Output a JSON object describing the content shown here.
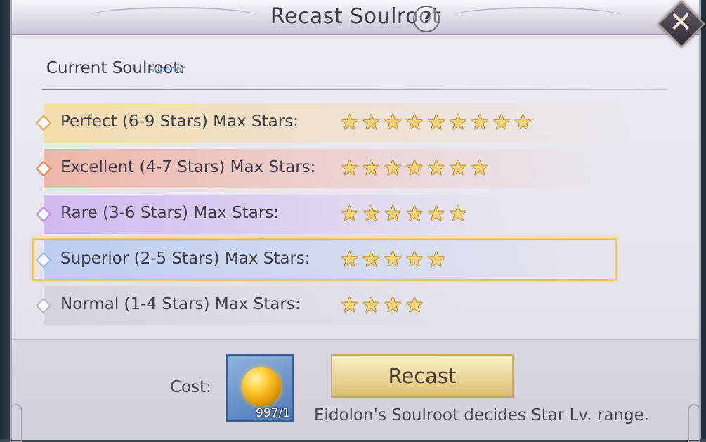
{
  "dialog": {
    "title": "Recast Soulroot",
    "help_icon": "question-mark-icon",
    "close_icon": "close-x-icon"
  },
  "current": {
    "label": "Current Soulroot:",
    "value": "Superior"
  },
  "grades": [
    {
      "label": "Perfect (6-9 Stars) Max Stars:",
      "max_stars": 9,
      "stars": "★★★★★★★★★",
      "band": "linear-gradient(90deg, rgba(247,218,150,0.75) 0%, rgba(243,221,190,0.55) 55%, rgba(235,230,240,0) 100%)",
      "accent": "#f0a040",
      "selected": false
    },
    {
      "label": "Excellent (4-7 Stars) Max Stars:",
      "max_stars": 7,
      "stars": "★★★★★★★",
      "band": "linear-gradient(90deg, rgba(240,170,150,0.8) 0%, rgba(238,195,188,0.55) 55%, rgba(235,230,240,0) 100%)",
      "accent": "#ef7a4a",
      "selected": false
    },
    {
      "label": "Rare (3-6 Stars) Max Stars:",
      "max_stars": 6,
      "stars": "★★★★★★",
      "band": "linear-gradient(90deg, rgba(200,170,240,0.75) 0%, rgba(210,195,240,0.55) 55%, rgba(235,230,240,0) 100%)",
      "accent": "#b58bec",
      "selected": false
    },
    {
      "label": "Superior (2-5 Stars) Max Stars:",
      "max_stars": 5,
      "stars": "★★★★★",
      "band": "linear-gradient(90deg, rgba(170,195,240,0.7) 0%, rgba(195,210,242,0.55) 55%, rgba(235,230,240,0) 100%)",
      "accent": "#8fb0ec",
      "selected": true
    },
    {
      "label": "Normal (1-4 Stars) Max Stars:",
      "max_stars": 4,
      "stars": "★★★★",
      "band": "linear-gradient(90deg, rgba(205,205,215,0.7) 0%, rgba(215,215,225,0.5) 55%, rgba(235,230,240,0) 100%)",
      "accent": "#b8b4c4",
      "selected": false
    }
  ],
  "footer": {
    "cost_label": "Cost:",
    "cost_item_icon": "gold-orb-icon",
    "cost_quantity": "997/1",
    "recast_label": "Recast",
    "hint": "Eidolon's Soulroot decides Star Lv. range."
  },
  "colors": {
    "selection_border": "#f1c75b",
    "star_fill": "#f4d27a"
  }
}
